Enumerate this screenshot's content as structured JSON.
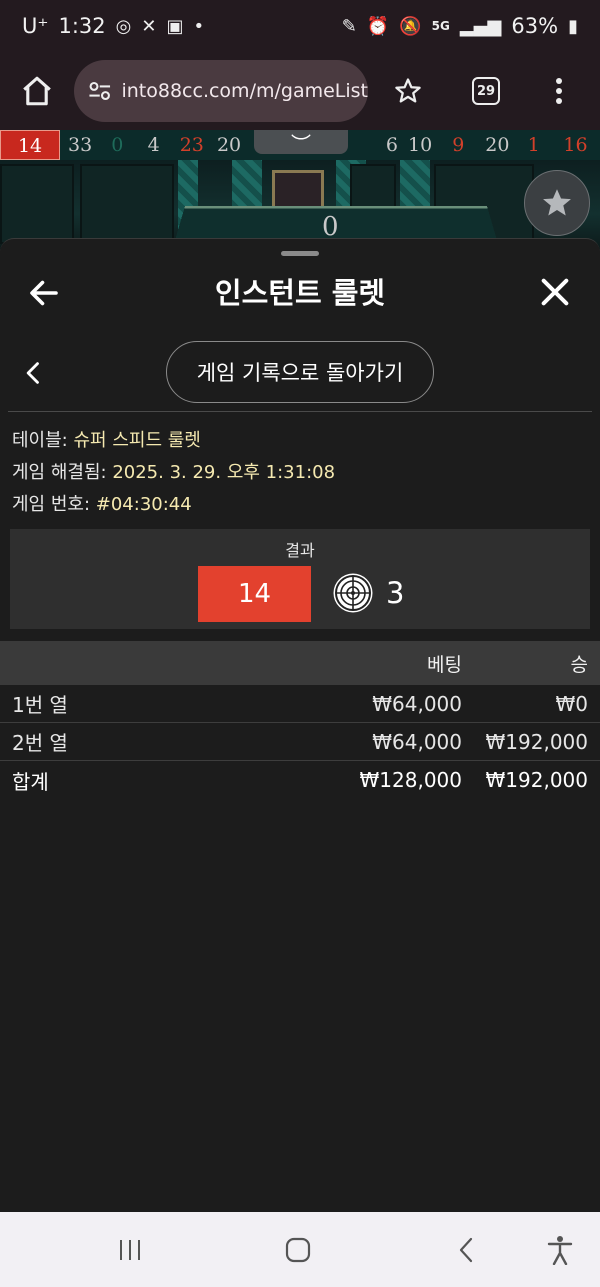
{
  "status_bar": {
    "carrier": "U⁺",
    "time": "1:32",
    "battery": "63%",
    "network": "5G"
  },
  "browser": {
    "url": "into88cc.com/m/gameList",
    "tab_count": "29"
  },
  "number_strip": [
    "14",
    "33",
    "0",
    "4",
    "23",
    "20",
    "6",
    "10",
    "9",
    "20",
    "1",
    "16"
  ],
  "number_colors": {
    "red": "#c8281e",
    "black": "#c9c9c9",
    "green": "#1e6b5a",
    "red_text": "#d2402a"
  },
  "game": {
    "wheel_number": "0"
  },
  "sheet": {
    "title": "인스턴트 룰렛",
    "history_button": "게임 기록으로 돌아가기",
    "info": {
      "table_label": "테이블:",
      "table_value": "슈퍼 스피드 룰렛",
      "resolved_label": "게임 해결됨:",
      "resolved_value": "2025. 3. 29. 오후 1:31:08",
      "game_no_label": "게임 번호:",
      "game_no_value": "#04:30:44"
    },
    "result": {
      "label": "결과",
      "number": "14",
      "number_color": "#e3412e",
      "multiplier": "3"
    },
    "table": {
      "headers": [
        "",
        "베팅",
        "승"
      ],
      "rows": [
        {
          "name": "1번 열",
          "bet": "₩64,000",
          "win": "₩0"
        },
        {
          "name": "2번 열",
          "bet": "₩64,000",
          "win": "₩192,000"
        }
      ],
      "total": {
        "name": "합계",
        "bet": "₩128,000",
        "win": "₩192,000"
      }
    }
  }
}
